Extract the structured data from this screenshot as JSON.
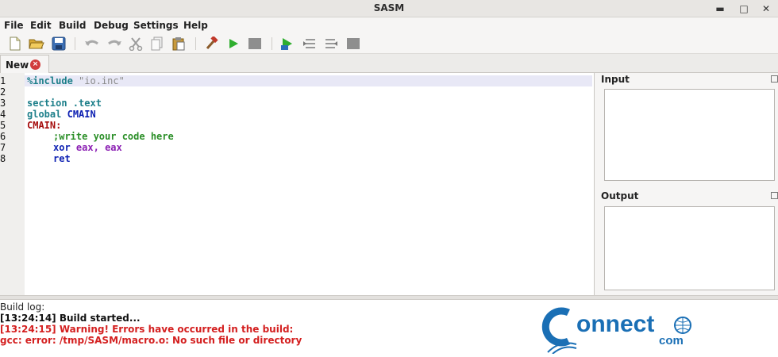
{
  "window": {
    "title": "SASM"
  },
  "window_controls": {
    "minimize": "▬",
    "maximize": "□",
    "close": "✕"
  },
  "menu": [
    "File",
    "Edit",
    "Build",
    "Debug",
    "Settings",
    "Help"
  ],
  "toolbar": {
    "icons": [
      "new-file-icon",
      "open-folder-icon",
      "save-icon",
      "undo-icon",
      "redo-icon",
      "cut-icon",
      "copy-icon",
      "paste-icon",
      "build-hammer-icon",
      "run-icon",
      "stop-icon",
      "debug-icon",
      "step-into-icon",
      "step-over-icon",
      "debug-stop-icon"
    ]
  },
  "tabs": [
    {
      "label": "New",
      "close": "×"
    }
  ],
  "editor": {
    "line_numbers": [
      "1",
      "2",
      "3",
      "4",
      "5",
      "6",
      "7",
      "8"
    ],
    "code": {
      "l1_directive": "%include",
      "l1_string": "\"io.inc\"",
      "l3": "section .text",
      "l4_kw": "global",
      "l4_name": "CMAIN",
      "l5": "CMAIN:",
      "l6": ";write your code here",
      "l7_kw": "xor",
      "l7_r1": "eax",
      "l7_sep": ",",
      "l7_r2": "eax",
      "l8": "ret"
    }
  },
  "side_panels": {
    "input": {
      "title": "Input"
    },
    "output": {
      "title": "Output"
    }
  },
  "build_log": {
    "header": "Build log:",
    "lines": [
      {
        "text": "[13:24:14] Build started...",
        "color": "#111111"
      },
      {
        "text": "[13:24:15] Warning! Errors have occurred in the build:",
        "color": "#d42020"
      },
      {
        "text": "gcc: error: /tmp/SASM/macro.o: No such file or directory",
        "color": "#d42020"
      }
    ]
  },
  "watermark": {
    "word": "onnect",
    "suffix": "com",
    "brand_color": "#1a6fb5"
  }
}
